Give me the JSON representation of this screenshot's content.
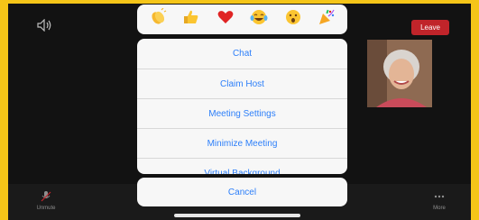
{
  "topbar": {
    "leave_label": "Leave"
  },
  "reactions": [
    {
      "icon": "clapping-hands-icon"
    },
    {
      "icon": "thumbs-up-icon"
    },
    {
      "icon": "red-heart-icon"
    },
    {
      "icon": "tears-of-joy-icon"
    },
    {
      "icon": "surprised-face-icon"
    },
    {
      "icon": "party-popper-icon"
    }
  ],
  "menu": {
    "items": [
      {
        "label": "Chat"
      },
      {
        "label": "Claim Host"
      },
      {
        "label": "Meeting Settings"
      },
      {
        "label": "Minimize Meeting"
      },
      {
        "label": "Virtual Background"
      }
    ],
    "cancel_label": "Cancel"
  },
  "bottombar": {
    "unmute_label": "Unmute",
    "more_label": "More"
  },
  "colors": {
    "accent": "#2d7ff9",
    "leave": "#c0242a",
    "frame": "#f5c518"
  }
}
